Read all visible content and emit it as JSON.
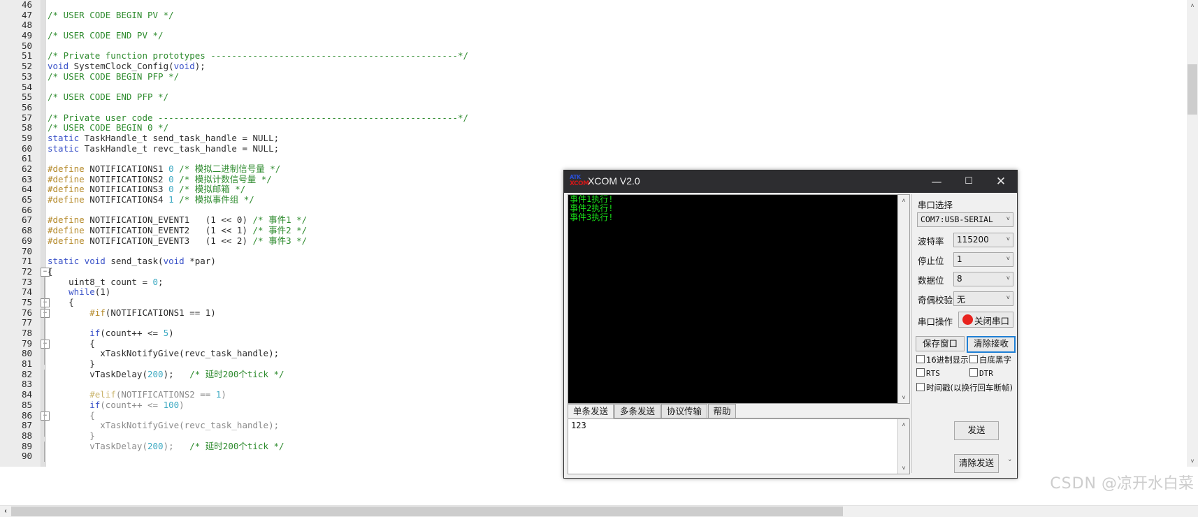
{
  "editor": {
    "lines": [
      {
        "n": "46",
        "fold": "",
        "text": []
      },
      {
        "n": "47",
        "fold": "",
        "text": [
          {
            "c": "cmt",
            "t": "/* USER CODE BEGIN PV */"
          }
        ]
      },
      {
        "n": "48",
        "fold": "",
        "text": []
      },
      {
        "n": "49",
        "fold": "",
        "text": [
          {
            "c": "cmt",
            "t": "/* USER CODE END PV */"
          }
        ]
      },
      {
        "n": "50",
        "fold": "",
        "text": []
      },
      {
        "n": "51",
        "fold": "",
        "text": [
          {
            "c": "cmt",
            "t": "/* Private function prototypes -----------------------------------------------*/"
          }
        ]
      },
      {
        "n": "52",
        "fold": "",
        "text": [
          {
            "c": "kw",
            "t": "void"
          },
          {
            "c": "plain",
            "t": " SystemClock_Config("
          },
          {
            "c": "kw",
            "t": "void"
          },
          {
            "c": "plain",
            "t": ");"
          }
        ]
      },
      {
        "n": "53",
        "fold": "",
        "text": [
          {
            "c": "cmt",
            "t": "/* USER CODE BEGIN PFP */"
          }
        ]
      },
      {
        "n": "54",
        "fold": "",
        "text": []
      },
      {
        "n": "55",
        "fold": "",
        "text": [
          {
            "c": "cmt",
            "t": "/* USER CODE END PFP */"
          }
        ]
      },
      {
        "n": "56",
        "fold": "",
        "text": []
      },
      {
        "n": "57",
        "fold": "",
        "text": [
          {
            "c": "cmt",
            "t": "/* Private user code ---------------------------------------------------------*/"
          }
        ]
      },
      {
        "n": "58",
        "fold": "",
        "text": [
          {
            "c": "cmt",
            "t": "/* USER CODE BEGIN 0 */"
          }
        ]
      },
      {
        "n": "59",
        "fold": "",
        "text": [
          {
            "c": "kw",
            "t": "static"
          },
          {
            "c": "plain",
            "t": " TaskHandle_t send_task_handle = NULL;"
          }
        ]
      },
      {
        "n": "60",
        "fold": "",
        "text": [
          {
            "c": "kw",
            "t": "static"
          },
          {
            "c": "plain",
            "t": " TaskHandle_t revc_task_handle = NULL;"
          }
        ]
      },
      {
        "n": "61",
        "fold": "",
        "text": []
      },
      {
        "n": "62",
        "fold": "",
        "text": [
          {
            "c": "pp",
            "t": "#define"
          },
          {
            "c": "plain",
            "t": " NOTIFICATIONS1 "
          },
          {
            "c": "num2",
            "t": "0"
          },
          {
            "c": "cmt",
            "t": " /* 模拟二进制信号量 */"
          }
        ]
      },
      {
        "n": "63",
        "fold": "",
        "text": [
          {
            "c": "pp",
            "t": "#define"
          },
          {
            "c": "plain",
            "t": " NOTIFICATIONS2 "
          },
          {
            "c": "num2",
            "t": "0"
          },
          {
            "c": "cmt",
            "t": " /* 模拟计数信号量 */"
          }
        ]
      },
      {
        "n": "64",
        "fold": "",
        "text": [
          {
            "c": "pp",
            "t": "#define"
          },
          {
            "c": "plain",
            "t": " NOTIFICATIONS3 "
          },
          {
            "c": "num2",
            "t": "0"
          },
          {
            "c": "cmt",
            "t": " /* 模拟邮箱 */"
          }
        ]
      },
      {
        "n": "65",
        "fold": "",
        "text": [
          {
            "c": "pp",
            "t": "#define"
          },
          {
            "c": "plain",
            "t": " NOTIFICATIONS4 "
          },
          {
            "c": "num2",
            "t": "1"
          },
          {
            "c": "cmt",
            "t": " /* 模拟事件组 */"
          }
        ]
      },
      {
        "n": "66",
        "fold": "",
        "text": []
      },
      {
        "n": "67",
        "fold": "",
        "text": [
          {
            "c": "pp",
            "t": "#define"
          },
          {
            "c": "plain",
            "t": " NOTIFICATION_EVENT1   (1 << 0) "
          },
          {
            "c": "cmt",
            "t": "/* 事件1 */"
          }
        ]
      },
      {
        "n": "68",
        "fold": "",
        "text": [
          {
            "c": "pp",
            "t": "#define"
          },
          {
            "c": "plain",
            "t": " NOTIFICATION_EVENT2   (1 << 1) "
          },
          {
            "c": "cmt",
            "t": "/* 事件2 */"
          }
        ]
      },
      {
        "n": "69",
        "fold": "",
        "text": [
          {
            "c": "pp",
            "t": "#define"
          },
          {
            "c": "plain",
            "t": " NOTIFICATION_EVENT3   (1 << 2) "
          },
          {
            "c": "cmt",
            "t": "/* 事件3 */"
          }
        ]
      },
      {
        "n": "70",
        "fold": "",
        "text": []
      },
      {
        "n": "71",
        "fold": "",
        "text": [
          {
            "c": "kw",
            "t": "static void"
          },
          {
            "c": "plain",
            "t": " send_task("
          },
          {
            "c": "kw",
            "t": "void"
          },
          {
            "c": "plain",
            "t": " *par)"
          }
        ]
      },
      {
        "n": "72",
        "fold": "box",
        "text": [
          {
            "c": "plain",
            "t": "{"
          }
        ]
      },
      {
        "n": "73",
        "fold": "v",
        "text": [
          {
            "c": "plain",
            "t": "    uint8_t count = "
          },
          {
            "c": "num2",
            "t": "0"
          },
          {
            "c": "plain",
            "t": ";"
          }
        ]
      },
      {
        "n": "74",
        "fold": "v",
        "text": [
          {
            "c": "plain",
            "t": "    "
          },
          {
            "c": "kw",
            "t": "while"
          },
          {
            "c": "plain",
            "t": "(1)"
          }
        ]
      },
      {
        "n": "75",
        "fold": "boxv",
        "text": [
          {
            "c": "plain",
            "t": "    {"
          }
        ]
      },
      {
        "n": "76",
        "fold": "boxv",
        "text": [
          {
            "c": "plain",
            "t": "        "
          },
          {
            "c": "pp",
            "t": "#if"
          },
          {
            "c": "plain",
            "t": "(NOTIFICATIONS1 == 1)"
          }
        ]
      },
      {
        "n": "77",
        "fold": "v",
        "text": []
      },
      {
        "n": "78",
        "fold": "v",
        "text": [
          {
            "c": "plain",
            "t": "        "
          },
          {
            "c": "kw",
            "t": "if"
          },
          {
            "c": "plain",
            "t": "(count++ <= "
          },
          {
            "c": "num2",
            "t": "5"
          },
          {
            "c": "plain",
            "t": ")"
          }
        ]
      },
      {
        "n": "79",
        "fold": "boxv",
        "text": [
          {
            "c": "plain",
            "t": "        {"
          }
        ]
      },
      {
        "n": "80",
        "fold": "v",
        "text": [
          {
            "c": "plain",
            "t": "          xTaskNotifyGive(revc_task_handle);"
          }
        ]
      },
      {
        "n": "81",
        "fold": "halfv",
        "text": [
          {
            "c": "plain",
            "t": "        }"
          }
        ]
      },
      {
        "n": "82",
        "fold": "v",
        "text": [
          {
            "c": "plain",
            "t": "        vTaskDelay("
          },
          {
            "c": "num2",
            "t": "200"
          },
          {
            "c": "plain",
            "t": ");   "
          },
          {
            "c": "cmt",
            "t": "/* 延时200个tick */"
          }
        ]
      },
      {
        "n": "83",
        "fold": "v",
        "text": []
      },
      {
        "n": "84",
        "fold": "v",
        "text": [
          {
            "c": "plain",
            "t": "        "
          },
          {
            "c": "pp-dim",
            "t": "#elif"
          },
          {
            "c": "id-dim",
            "t": "(NOTIFICATIONS2 == "
          },
          {
            "c": "num2",
            "t": "1"
          },
          {
            "c": "id-dim",
            "t": ")"
          }
        ]
      },
      {
        "n": "85",
        "fold": "v",
        "text": [
          {
            "c": "id-dim",
            "t": "        "
          },
          {
            "c": "kw",
            "t": "if"
          },
          {
            "c": "id-dim",
            "t": "(count++ <= "
          },
          {
            "c": "num2",
            "t": "100"
          },
          {
            "c": "id-dim",
            "t": ")"
          }
        ]
      },
      {
        "n": "86",
        "fold": "boxv",
        "text": [
          {
            "c": "id-dim",
            "t": "        {"
          }
        ]
      },
      {
        "n": "87",
        "fold": "v",
        "text": [
          {
            "c": "id-dim",
            "t": "          xTaskNotifyGive(revc_task_handle);"
          }
        ]
      },
      {
        "n": "88",
        "fold": "halfv",
        "text": [
          {
            "c": "id-dim",
            "t": "        }"
          }
        ]
      },
      {
        "n": "89",
        "fold": "v",
        "text": [
          {
            "c": "id-dim",
            "t": "        vTaskDelay("
          },
          {
            "c": "num2",
            "t": "200"
          },
          {
            "c": "id-dim",
            "t": ");   "
          },
          {
            "c": "cmt",
            "t": "/* 延时200个tick */"
          }
        ]
      },
      {
        "n": "90",
        "fold": "v",
        "text": []
      }
    ],
    "scroll_left_arrow": "‹",
    "scroll_up_arrow": "˄",
    "scroll_down_arrow": "˅"
  },
  "xcom": {
    "title": "XCOM V2.0",
    "logo_top": "ATK",
    "logo_bottom": "XCOM",
    "minimize": "—",
    "maximize": "☐",
    "close": "✕",
    "terminal": {
      "lines": [
        "事件1执行!",
        "事件2执行!",
        "事件3执行!"
      ],
      "scroll_up": "˄",
      "scroll_down": "˅"
    },
    "tabs": [
      {
        "label": "单条发送",
        "active": true
      },
      {
        "label": "多条发送",
        "active": false
      },
      {
        "label": "协议传输",
        "active": false
      },
      {
        "label": "帮助",
        "active": false
      }
    ],
    "send_input": {
      "value": "123",
      "scroll_up": "˄",
      "scroll_down": "˅"
    },
    "settings": {
      "port_select_label": "串口选择",
      "port_value": "COM7:USB-SERIAL",
      "baud_label": "波特率",
      "baud_value": "115200",
      "stopbit_label": "停止位",
      "stopbit_value": "1",
      "databit_label": "数据位",
      "databit_value": "8",
      "parity_label": "奇偶校验",
      "parity_value": "无",
      "operation_label": "串口操作",
      "operation_button": "关闭串口",
      "save_window_button": "保存窗口",
      "clear_receive_button": "清除接收",
      "checkbox_hex_display": "16进制显示",
      "checkbox_white_bg": "白底黑字",
      "checkbox_rts": "RTS",
      "checkbox_dtr": "DTR",
      "checkbox_timestamp": "时间戳(以换行回车断帧)",
      "dropdown_arrow": "˅"
    },
    "send_button": "发送",
    "clear_send_button": "清除发送",
    "status_arrow": "˅"
  },
  "watermark": {
    "brand": "CSDN",
    "author": "@凉开水白菜"
  },
  "colors": {
    "titlebar_bg": "#2d2d30",
    "terminal_text": "#19e019",
    "comment": "#2e8b2e",
    "keyword": "#3a52c8",
    "number": "#3aa8c1",
    "preprocessor": "#b58a2b",
    "accent_focus": "#1f7fd4",
    "led_red": "#e8231e"
  }
}
